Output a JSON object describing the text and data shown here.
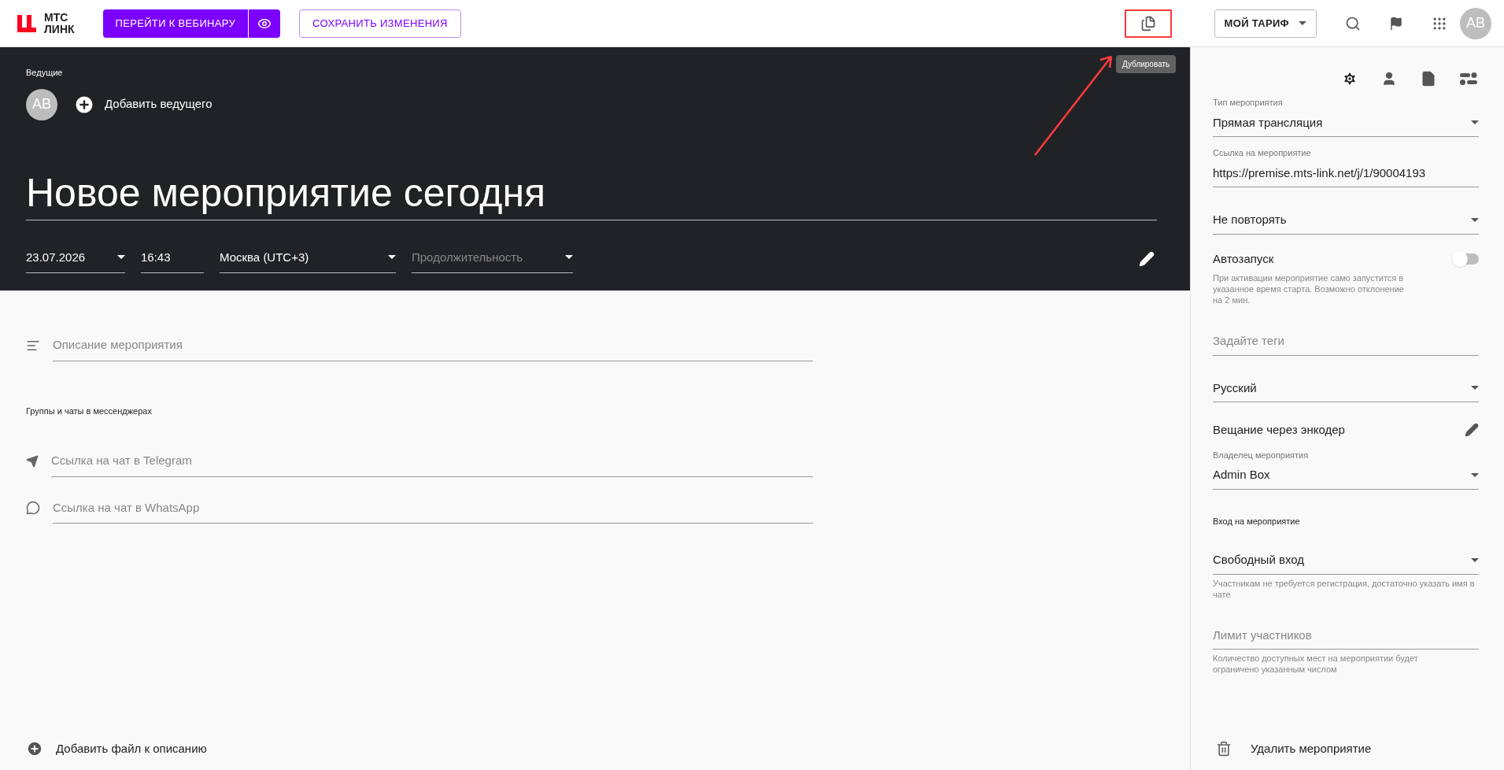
{
  "topbar": {
    "logo": [
      "МТС",
      "ЛИНК"
    ],
    "go_button": "ПЕРЕЙТИ К ВЕБИНАРУ",
    "save_button": "СОХРАНИТЬ ИЗМЕНЕНИЯ",
    "duplicate_tooltip": "Дублировать",
    "plan_button": "МОЙ ТАРИФ",
    "avatar": "AB"
  },
  "header": {
    "hosts_label": "Ведущие",
    "host_avatar": "AB",
    "add_host": "Добавить ведущего",
    "title": "Новое мероприятие сегодня",
    "date": "23.07.2026",
    "time": "16:43",
    "timezone": "Москва (UTC+3)",
    "duration_placeholder": "Продолжительность"
  },
  "main": {
    "description_placeholder": "Описание мероприятия",
    "messengers_label": "Группы и чаты в мессенджерах",
    "telegram_placeholder": "Ссылка на чат в Telegram",
    "whatsapp_placeholder": "Ссылка на чат в WhatsApp",
    "add_file": "Добавить файл к описанию"
  },
  "settings": {
    "fields": [
      {
        "kind": "select",
        "label": "Тип мероприятия",
        "value": "Прямая трансляция"
      },
      {
        "kind": "text",
        "label": "Ссылка на мероприятие",
        "value": "https://premise.mts-link.net/j/1/90004193"
      },
      {
        "kind": "select",
        "value": "Не повторять"
      },
      {
        "kind": "toggle",
        "label": "Автозапуск",
        "on": false,
        "hint": "При активации мероприятие само запустится в указанное время старта. Возможно отклонение на 2 мин."
      },
      {
        "kind": "input",
        "placeholder": "Задайте теги"
      },
      {
        "kind": "select",
        "value": "Русский"
      },
      {
        "kind": "edit",
        "label": "Вещание через энкодер"
      },
      {
        "kind": "select",
        "label": "Владелец мероприятия",
        "value": "Admin Box"
      },
      {
        "kind": "heading",
        "label": "Вход на мероприятие"
      },
      {
        "kind": "select",
        "value": "Свободный вход",
        "hint": "Участникам не требуется регистрация, достаточно указать имя в чате"
      },
      {
        "kind": "input",
        "placeholder": "Лимит участников",
        "hint": "Количество доступных мест на мероприятии будет ограничено указанным числом"
      }
    ],
    "delete": "Удалить мероприятие"
  }
}
